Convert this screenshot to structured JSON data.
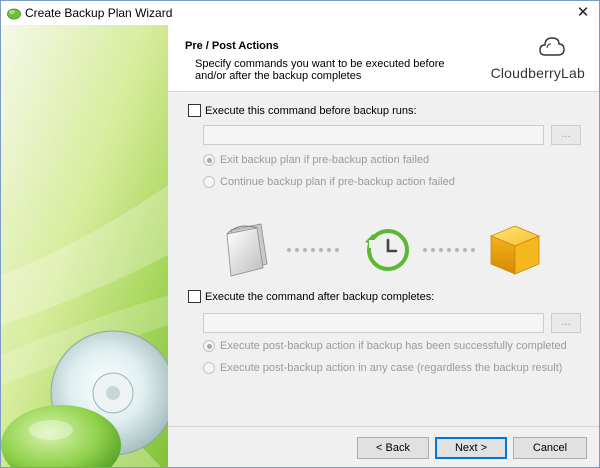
{
  "window": {
    "title": "Create Backup Plan Wizard",
    "close_glyph": "✕"
  },
  "header": {
    "title": "Pre / Post Actions",
    "description": "Specify commands you want to be executed before and/or after the backup completes",
    "brand": "CloudberryLab"
  },
  "pre_backup": {
    "checkbox_label": "Execute this command before backup runs:",
    "checked": false,
    "command_value": "",
    "browse_label": "...",
    "options": [
      {
        "label": "Exit backup plan if pre-backup action failed",
        "selected": true
      },
      {
        "label": "Continue backup plan if pre-backup action failed",
        "selected": false
      }
    ]
  },
  "post_backup": {
    "checkbox_label": "Execute the command after backup completes:",
    "checked": false,
    "command_value": "",
    "browse_label": "...",
    "options": [
      {
        "label": "Execute post-backup action if backup has been successfully completed",
        "selected": true
      },
      {
        "label": "Execute post-backup action in any case (regardless the backup result)",
        "selected": false
      }
    ]
  },
  "illustration": {
    "icons": [
      "documents-icon",
      "clock-arrow-icon",
      "storage-cube-icon"
    ]
  },
  "buttons": {
    "back": "< Back",
    "next": "Next >",
    "cancel": "Cancel"
  },
  "colors": {
    "accent_green": "#5cb833",
    "cube_gold": "#f2b51c",
    "primary_border": "#0078d7"
  }
}
